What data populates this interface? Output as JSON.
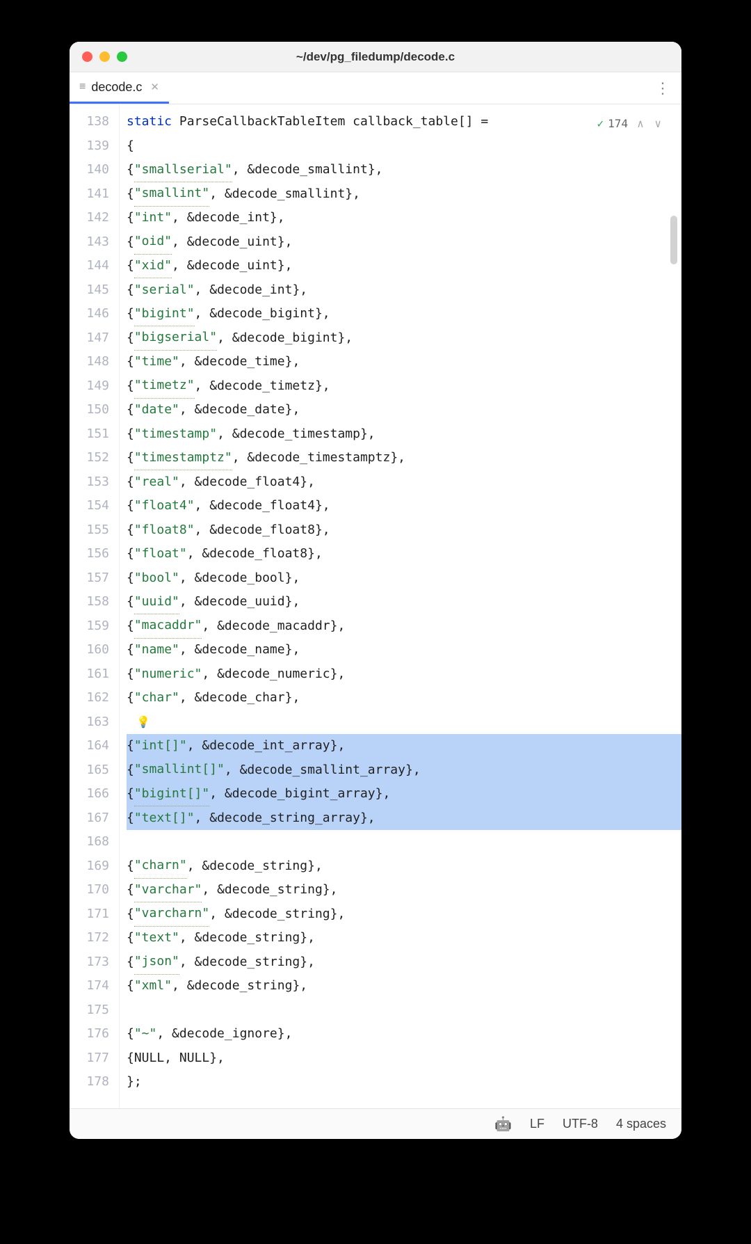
{
  "window": {
    "title": "~/dev/pg_filedump/decode.c"
  },
  "tab": {
    "name": "decode.c"
  },
  "badge": {
    "count": "174"
  },
  "status": {
    "lf": "LF",
    "encoding": "UTF-8",
    "indent": "4 spaces"
  },
  "code": {
    "first_line_no": 138,
    "lines": [
      {
        "n": 138,
        "tokens": [
          [
            "kw",
            "static"
          ],
          [
            "",
            ""
          ],
          [
            "fn",
            " ParseCallbackTableItem callback_table[] ="
          ]
        ]
      },
      {
        "n": 139,
        "tokens": [
          [
            "punc",
            "{"
          ]
        ]
      },
      {
        "n": 140,
        "indent": 2,
        "entry": {
          "name": "smallserial",
          "fn": "decode_smallint",
          "ul": true
        }
      },
      {
        "n": 141,
        "indent": 2,
        "entry": {
          "name": "smallint",
          "fn": "decode_smallint",
          "ul": true
        }
      },
      {
        "n": 142,
        "indent": 2,
        "entry": {
          "name": "int",
          "fn": "decode_int"
        }
      },
      {
        "n": 143,
        "indent": 2,
        "entry": {
          "name": "oid",
          "fn": "decode_uint",
          "ul": true
        }
      },
      {
        "n": 144,
        "indent": 2,
        "entry": {
          "name": "xid",
          "fn": "decode_uint",
          "ul": true
        }
      },
      {
        "n": 145,
        "indent": 2,
        "entry": {
          "name": "serial",
          "fn": "decode_int"
        }
      },
      {
        "n": 146,
        "indent": 2,
        "entry": {
          "name": "bigint",
          "fn": "decode_bigint",
          "ul": true
        }
      },
      {
        "n": 147,
        "indent": 2,
        "entry": {
          "name": "bigserial",
          "fn": "decode_bigint",
          "ul": true
        }
      },
      {
        "n": 148,
        "indent": 2,
        "entry": {
          "name": "time",
          "fn": "decode_time"
        }
      },
      {
        "n": 149,
        "indent": 2,
        "entry": {
          "name": "timetz",
          "fn": "decode_timetz",
          "ul": true
        }
      },
      {
        "n": 150,
        "indent": 2,
        "entry": {
          "name": "date",
          "fn": "decode_date"
        }
      },
      {
        "n": 151,
        "indent": 2,
        "entry": {
          "name": "timestamp",
          "fn": "decode_timestamp"
        }
      },
      {
        "n": 152,
        "indent": 2,
        "entry": {
          "name": "timestamptz",
          "fn": "decode_timestamptz",
          "ul": true
        }
      },
      {
        "n": 153,
        "indent": 2,
        "entry": {
          "name": "real",
          "fn": "decode_float4"
        }
      },
      {
        "n": 154,
        "indent": 2,
        "entry": {
          "name": "float4",
          "fn": "decode_float4"
        }
      },
      {
        "n": 155,
        "indent": 2,
        "entry": {
          "name": "float8",
          "fn": "decode_float8"
        }
      },
      {
        "n": 156,
        "indent": 2,
        "entry": {
          "name": "float",
          "fn": "decode_float8"
        }
      },
      {
        "n": 157,
        "indent": 2,
        "entry": {
          "name": "bool",
          "fn": "decode_bool"
        }
      },
      {
        "n": 158,
        "indent": 2,
        "entry": {
          "name": "uuid",
          "fn": "decode_uuid",
          "ul": true
        }
      },
      {
        "n": 159,
        "indent": 2,
        "entry": {
          "name": "macaddr",
          "fn": "decode_macaddr",
          "ul": true
        }
      },
      {
        "n": 160,
        "indent": 2,
        "entry": {
          "name": "name",
          "fn": "decode_name"
        }
      },
      {
        "n": 161,
        "indent": 2,
        "entry": {
          "name": "numeric",
          "fn": "decode_numeric"
        }
      },
      {
        "n": 162,
        "indent": 2,
        "entry": {
          "name": "char",
          "fn": "decode_char"
        }
      },
      {
        "n": 163,
        "bulb": true,
        "tokens": []
      },
      {
        "n": 164,
        "hl": true,
        "indent": 2,
        "entry": {
          "name": "int[]",
          "fn": "decode_int_array"
        }
      },
      {
        "n": 165,
        "hl": true,
        "indent": 2,
        "entry": {
          "name": "smallint[]",
          "fn": "decode_smallint_array",
          "ul": true
        }
      },
      {
        "n": 166,
        "hl": true,
        "indent": 2,
        "entry": {
          "name": "bigint[]",
          "fn": "decode_bigint_array",
          "ul": true
        }
      },
      {
        "n": 167,
        "hl": true,
        "indent": 2,
        "entry": {
          "name": "text[]",
          "fn": "decode_string_array"
        }
      },
      {
        "n": 168,
        "tokens": []
      },
      {
        "n": 169,
        "indent": 2,
        "entry": {
          "name": "charn",
          "fn": "decode_string",
          "ul": true
        }
      },
      {
        "n": 170,
        "indent": 2,
        "entry": {
          "name": "varchar",
          "fn": "decode_string",
          "ul": true
        }
      },
      {
        "n": 171,
        "indent": 2,
        "entry": {
          "name": "varcharn",
          "fn": "decode_string",
          "ul": true
        }
      },
      {
        "n": 172,
        "indent": 2,
        "entry": {
          "name": "text",
          "fn": "decode_string"
        }
      },
      {
        "n": 173,
        "indent": 2,
        "entry": {
          "name": "json",
          "fn": "decode_string",
          "ul": true
        }
      },
      {
        "n": 174,
        "indent": 2,
        "entry": {
          "name": "xml",
          "fn": "decode_string"
        }
      },
      {
        "n": 175,
        "tokens": []
      },
      {
        "n": 176,
        "indent": 2,
        "entry": {
          "name": "~",
          "fn": "decode_ignore"
        }
      },
      {
        "n": 177,
        "indent": 2,
        "raw": "{NULL, NULL},"
      },
      {
        "n": 178,
        "tokens": [
          [
            "punc",
            "};"
          ]
        ]
      }
    ]
  }
}
